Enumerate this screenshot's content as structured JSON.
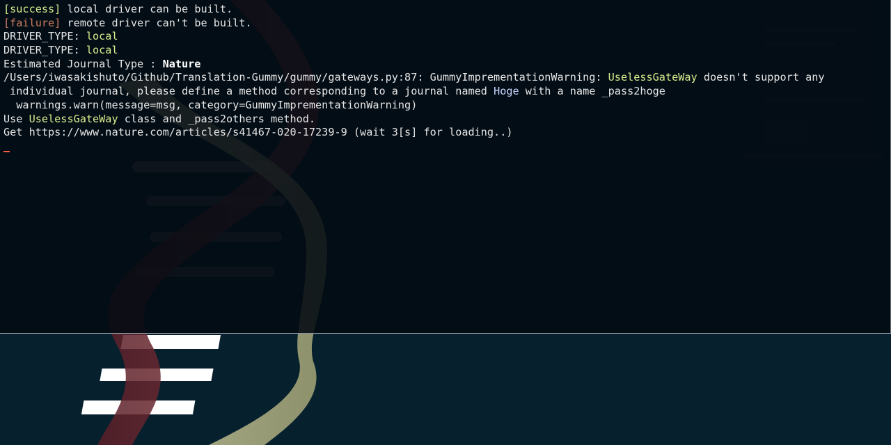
{
  "terminal": {
    "lines": [
      {
        "parts": [
          {
            "t": "[success]",
            "c": "ok"
          },
          {
            "t": " local driver can be built.",
            "c": ""
          }
        ]
      },
      {
        "parts": [
          {
            "t": "[failure]",
            "c": "fail"
          },
          {
            "t": " remote driver can't be built.",
            "c": ""
          }
        ]
      },
      {
        "parts": [
          {
            "t": "DRIVER_TYPE: ",
            "c": ""
          },
          {
            "t": "local",
            "c": "ok"
          }
        ]
      },
      {
        "parts": [
          {
            "t": "DRIVER_TYPE: ",
            "c": ""
          },
          {
            "t": "local",
            "c": "ok"
          }
        ]
      },
      {
        "parts": [
          {
            "t": "Estimated Journal Type : ",
            "c": ""
          },
          {
            "t": "Nature",
            "c": "bold"
          }
        ]
      },
      {
        "parts": [
          {
            "t": "/Users/iwasakishuto/Github/Translation-Gummy/gummy/gateways.py:87: GummyImprementationWarning: ",
            "c": ""
          },
          {
            "t": "UselessGateWay",
            "c": "hl"
          },
          {
            "t": " doesn't support any",
            "c": ""
          }
        ]
      },
      {
        "parts": [
          {
            "t": " individual journal, please define a method corresponding to a journal named ",
            "c": ""
          },
          {
            "t": "Hoge",
            "c": "blue"
          },
          {
            "t": " with a name _pass2hoge",
            "c": ""
          }
        ]
      },
      {
        "parts": [
          {
            "t": "  warnings.warn(message=msg, category=GummyImprementationWarning)",
            "c": ""
          }
        ]
      },
      {
        "parts": [
          {
            "t": "Use ",
            "c": ""
          },
          {
            "t": "UselessGateWay",
            "c": "hl"
          },
          {
            "t": " class and _pass2others method.",
            "c": ""
          }
        ]
      },
      {
        "parts": [
          {
            "t": "Get https://www.nature.com/articles/s41467-020-17239-9 (wait 3[s] for loading..)",
            "c": ""
          }
        ]
      }
    ],
    "cursor_color": "#ff5a3c"
  },
  "background": {
    "strand_red": "#7a2f36",
    "strand_cream": "#d8d49c",
    "rung_white": "#ffffff",
    "backdrop": "#07202e"
  }
}
